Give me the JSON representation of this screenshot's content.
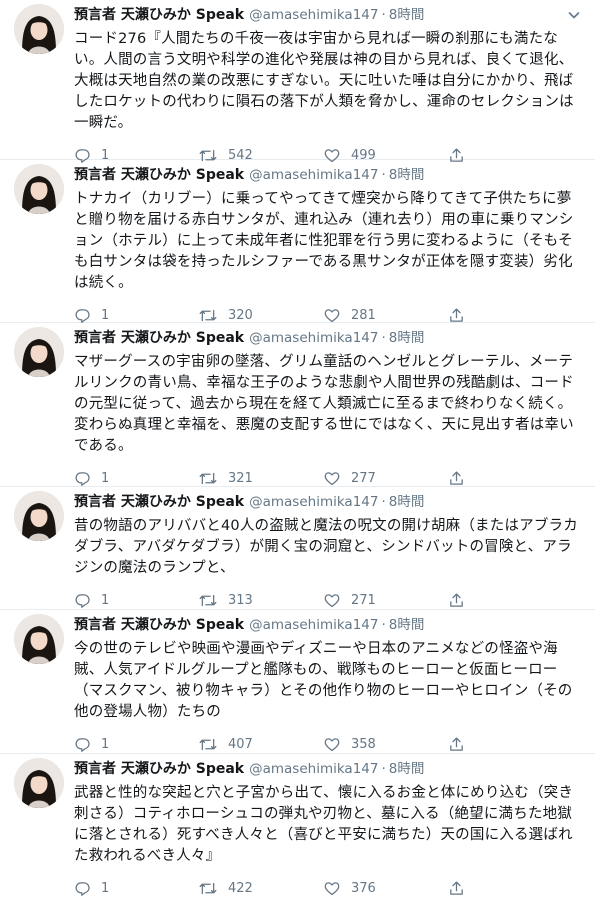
{
  "tweets": [
    {
      "name": "預言者 天瀬ひみか Speak",
      "handle": "@amasehimika147",
      "time": "8時間",
      "text": "コード276『人間たちの千夜一夜は宇宙から見れば一瞬の刹那にも満たない。人間の言う文明や科学の進化や発展は神の目から見れば、良くて退化、大概は天地自然の業の改悪にすぎない。天に吐いた唾は自分にかかり、飛ばしたロケットの代わりに隕石の落下が人類を脅かし、運命のセレクションは一瞬だ。",
      "replies": "1",
      "retweets": "542",
      "likes": "499"
    },
    {
      "name": "預言者 天瀬ひみか Speak",
      "handle": "@amasehimika147",
      "time": "8時間",
      "text": "トナカイ（カリブー）に乗ってやってきて煙突から降りてきて子供たちに夢と贈り物を届ける赤白サンタが、連れ込み（連れ去り）用の車に乗りマンション（ホテル）に上って未成年者に性犯罪を行う男に変わるように（そもそも白サンタは袋を持ったルシファーである黒サンタが正体を隠す変装）劣化は続く。",
      "replies": "1",
      "retweets": "320",
      "likes": "281"
    },
    {
      "name": "預言者 天瀬ひみか Speak",
      "handle": "@amasehimika147",
      "time": "8時間",
      "text": "マザーグースの宇宙卵の墜落、グリム童話のヘンゼルとグレーテル、メーテルリンクの青い鳥、幸福な王子のような悲劇や人間世界の残酷劇は、コードの元型に従って、過去から現在を経て人類滅亡に至るまで終わりなく続く。変わらぬ真理と幸福を、悪魔の支配する世にではなく、天に見出す者は幸いである。",
      "replies": "1",
      "retweets": "321",
      "likes": "277"
    },
    {
      "name": "預言者 天瀬ひみか Speak",
      "handle": "@amasehimika147",
      "time": "8時間",
      "text": "昔の物語のアリババと40人の盗賊と魔法の呪文の開け胡麻（またはアブラカダブラ、アバダケダブラ）が開く宝の洞窟と、シンドバットの冒険と、アラジンの魔法のランプと、",
      "replies": "1",
      "retweets": "313",
      "likes": "271"
    },
    {
      "name": "預言者 天瀬ひみか Speak",
      "handle": "@amasehimika147",
      "time": "8時間",
      "text": "今の世のテレビや映画や漫画やディズニーや日本のアニメなどの怪盗や海賊、人気アイドルグループと艦隊もの、戦隊ものヒーローと仮面ヒーロー（マスクマン、被り物キャラ）とその他作り物のヒーローやヒロイン（その他の登場人物）たちの",
      "replies": "1",
      "retweets": "407",
      "likes": "358"
    },
    {
      "name": "預言者 天瀬ひみか Speak",
      "handle": "@amasehimika147",
      "time": "8時間",
      "text": "武器と性的な突起と穴と子宮から出て、懐に入るお金と体にめり込む（突き刺さる）コティホローシュコの弾丸や刃物と、墓に入る（絶望に満ちた地獄に落とされる）死すべき人々と（喜びと平安に満ちた）天の国に入る選ばれた救われるべき人々』",
      "replies": "1",
      "retweets": "422",
      "likes": "376"
    }
  ],
  "colors": {
    "text": "#14171a",
    "secondary": "#657786",
    "divider": "#e6ecf0"
  },
  "icons": {
    "reply": "reply-icon",
    "retweet": "retweet-icon",
    "like": "heart-icon",
    "share": "share-icon",
    "menu": "chevron-down-icon"
  }
}
